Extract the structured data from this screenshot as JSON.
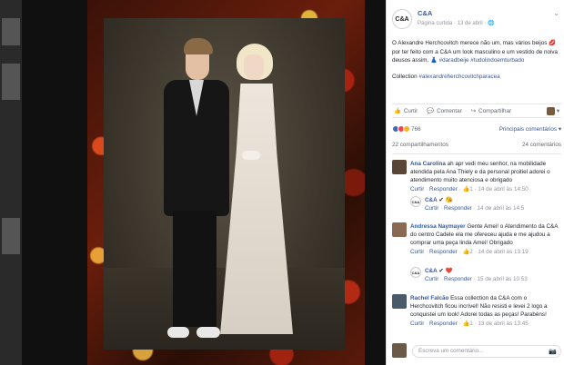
{
  "post": {
    "page_name": "C&A",
    "logo_text": "C&A",
    "meta": "Página curtida · 13 de abril ·",
    "caption_1": "O Alexandre Herchcovitch merece não um, mas vários beijos 💋 por ter feito com a C&A um look masculino e um vestido de noiva deusos assim. 👗",
    "hashtags_1": "#daradbeije #tudolindoemturbado",
    "caption_2": "Collection",
    "hashtag_2": "#alexandreherchcovitchparacea"
  },
  "actions": {
    "like": "Curtir",
    "comment": "Comentar",
    "share": "Compartilhar"
  },
  "reactions": {
    "count": "766",
    "sort_label": "Principais comentários ▾"
  },
  "stats": {
    "shares": "22 compartilhamentos",
    "comments": "24 comentários"
  },
  "comments": [
    {
      "name": "Ana Carolina",
      "text": "ah apr vedi meu senhor, na mobilidade atendida pela Ana Thiely e da personal proitiel adorei o atendimento muito atenciosa e obrigado",
      "like": "Curtir",
      "reply": "Responder",
      "likes": "1",
      "time": "14 de abril às 14:50",
      "reply_item": {
        "name": "C&A",
        "text": "😘",
        "like": "Curtir",
        "reply": "Responder",
        "time": "14 de abril às 14:5"
      }
    },
    {
      "name": "Andressa Naymayer",
      "text": "Gente Amei! o Atendimento da C&A do centro Cadele ela me ofereceu ajuda e me ajudou a comprar uma peça linda Amei! Obrigado",
      "like": "Curtir",
      "reply": "Responder",
      "likes": "2",
      "time": "14 de abril às 13:19",
      "reply_item": {
        "name": "C&A",
        "text": "❤️",
        "like": "Curtir",
        "reply": "Responder",
        "time": "15 de abril às 10:53"
      }
    },
    {
      "name": "Rachel Falcão",
      "text": "Essa collection da C&A com o Herchcovitch ficou incrível! Não resisti e levei 2 logo a conquistei um look! Adorei todas as peças! Parabéns!",
      "like": "Curtir",
      "reply": "Responder",
      "likes": "1",
      "time": "13 de abril às 13:45"
    }
  ],
  "composer": {
    "placeholder": "Escreva um comentário..."
  },
  "colors": {
    "link": "#365899",
    "meta": "#90949c",
    "backdrop": "#0c0c0c"
  }
}
